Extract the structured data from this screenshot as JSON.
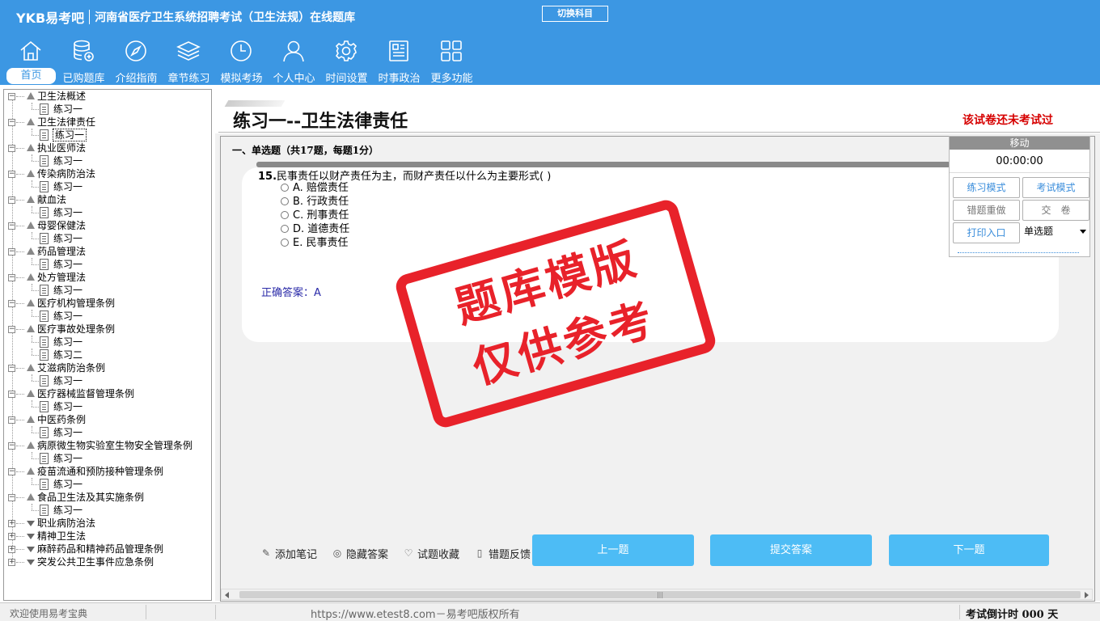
{
  "header": {
    "logo": "YKB易考吧",
    "title": "河南省医疗卫生系统招聘考试（卫生法规）在线题库",
    "switch_label": "切换科目"
  },
  "nav": [
    {
      "label": "首页",
      "icon": "home-icon"
    },
    {
      "label": "已购题库",
      "icon": "database-icon"
    },
    {
      "label": "介绍指南",
      "icon": "compass-icon"
    },
    {
      "label": "章节练习",
      "icon": "layers-icon"
    },
    {
      "label": "模拟考场",
      "icon": "clock-icon"
    },
    {
      "label": "个人中心",
      "icon": "user-icon"
    },
    {
      "label": "时间设置",
      "icon": "gear-icon"
    },
    {
      "label": "时事政治",
      "icon": "news-icon"
    },
    {
      "label": "更多功能",
      "icon": "grid-icon"
    }
  ],
  "tree": [
    {
      "label": "卫生法概述",
      "children": [
        "练习一"
      ]
    },
    {
      "label": "卫生法律责任",
      "children": [
        "练习一"
      ]
    },
    {
      "label": "执业医师法",
      "children": [
        "练习一"
      ]
    },
    {
      "label": "传染病防治法",
      "children": [
        "练习一"
      ]
    },
    {
      "label": "献血法",
      "children": [
        "练习一"
      ]
    },
    {
      "label": "母婴保健法",
      "children": [
        "练习一"
      ]
    },
    {
      "label": "药品管理法",
      "children": [
        "练习一"
      ]
    },
    {
      "label": "处方管理法",
      "children": [
        "练习一"
      ]
    },
    {
      "label": "医疗机构管理条例",
      "children": [
        "练习一"
      ]
    },
    {
      "label": "医疗事故处理条例",
      "children": [
        "练习一",
        "练习二"
      ]
    },
    {
      "label": "艾滋病防治条例",
      "children": [
        "练习一"
      ]
    },
    {
      "label": "医疗器械监督管理条例",
      "children": [
        "练习一"
      ]
    },
    {
      "label": "中医药条例",
      "children": [
        "练习一"
      ]
    },
    {
      "label": "病原微生物实验室生物安全管理条例",
      "children": [
        "练习一"
      ]
    },
    {
      "label": "疫苗流通和预防接种管理条例",
      "children": [
        "练习一"
      ]
    },
    {
      "label": "食品卫生法及其实施条例",
      "children": [
        "练习一"
      ]
    },
    {
      "label": "职业病防治法",
      "children": []
    },
    {
      "label": "精神卫生法",
      "children": []
    },
    {
      "label": "麻醉药品和精神药品管理条例",
      "children": []
    },
    {
      "label": "突发公共卫生事件应急条例",
      "children": []
    }
  ],
  "selected_node": "练习一",
  "main": {
    "paper_title": "练习一--卫生法律责任",
    "status": "该试卷还未考试过",
    "section": "一、单选题（共17题，每题1分）",
    "question_no": "15.",
    "question_text": "民事责任以财产责任为主，而财产责任以什么为主要形式( )",
    "options": [
      "A. 赔偿责任",
      "B. 行政责任",
      "C. 刑事责任",
      "D. 道德责任",
      "E. 民事责任"
    ],
    "answer": "正确答案：A",
    "stamp_line1": "题库模版",
    "stamp_line2": "仅供参考"
  },
  "actions": {
    "note": "添加笔记",
    "hide_answer": "隐藏答案",
    "favorite": "试题收藏",
    "feedback": "错题反馈",
    "prev": "上一题",
    "submit": "提交答案",
    "next": "下一题"
  },
  "panel": {
    "move": "移动",
    "timer": "00:00:00",
    "practice_mode": "练习模式",
    "exam_mode": "考试模式",
    "redo_wrong": "错题重做",
    "hand_in": "交　卷",
    "print": "打印入口",
    "question_type": "单选题"
  },
  "status_bar": {
    "welcome": "欢迎使用易考宝典",
    "url": "https://www.etest8.com－易考吧版权所有",
    "countdown": "考试倒计时 000 天"
  },
  "colors": {
    "header_bg": "#3c97e3",
    "button_blue": "#4dbcf5",
    "stamp_red": "#e8222a",
    "status_red": "#d60000"
  }
}
